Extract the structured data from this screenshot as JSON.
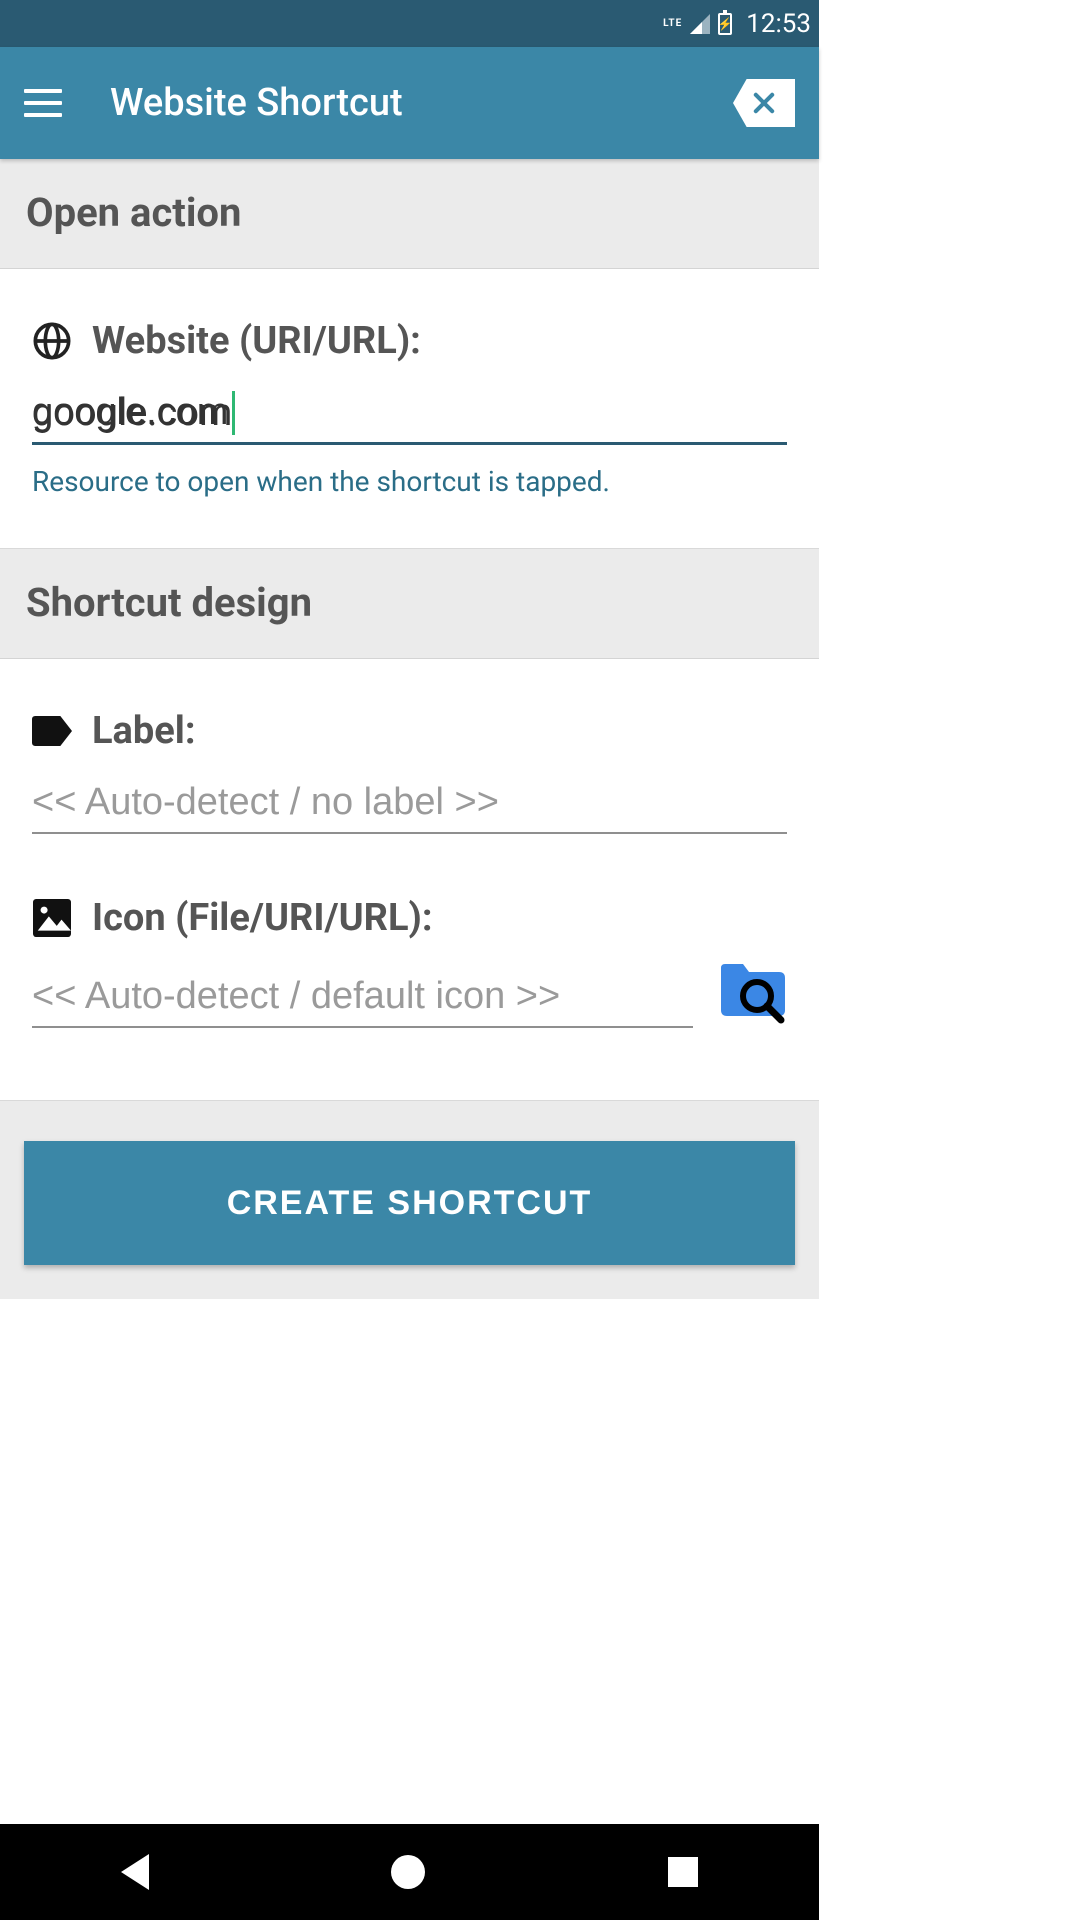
{
  "status_bar": {
    "network": "LTE",
    "time": "12:53",
    "battery_glyph": "⚡"
  },
  "app_bar": {
    "title": "Website Shortcut"
  },
  "sections": {
    "open_action": {
      "header": "Open action",
      "website": {
        "label": "Website (URI/URL):",
        "value": "google.com",
        "helper": "Resource to open when the shortcut is tapped."
      }
    },
    "shortcut_design": {
      "header": "Shortcut design",
      "label_field": {
        "label": "Label:",
        "placeholder": "<< Auto-detect / no label >>",
        "value": ""
      },
      "icon_field": {
        "label": "Icon (File/URI/URL):",
        "placeholder": "<< Auto-detect / default icon >>",
        "value": ""
      }
    }
  },
  "actions": {
    "create": "CREATE SHORTCUT"
  }
}
